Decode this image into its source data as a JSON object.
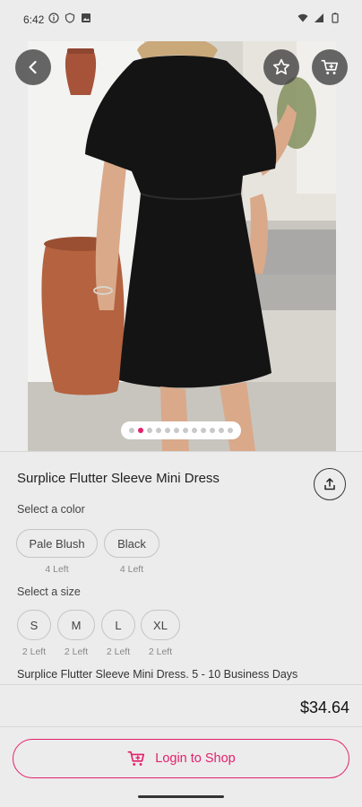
{
  "status_bar": {
    "time": "6:42"
  },
  "product": {
    "title": "Surplice Flutter Sleeve Mini Dress",
    "image_count": 12,
    "active_image_index": 1,
    "color_label": "Select a color",
    "colors": [
      {
        "name": "Pale Blush",
        "stock": "4 Left"
      },
      {
        "name": "Black",
        "stock": "4 Left"
      }
    ],
    "size_label": "Select a size",
    "sizes": [
      {
        "name": "S",
        "stock": "2 Left"
      },
      {
        "name": "M",
        "stock": "2 Left"
      },
      {
        "name": "L",
        "stock": "2 Left"
      },
      {
        "name": "XL",
        "stock": "2 Left"
      }
    ],
    "description": "Surplice Flutter Sleeve Mini Dress. 5 - 10 Business Days",
    "price": "$34.64"
  },
  "actions": {
    "login_label": "Login to Shop"
  },
  "colors": {
    "accent": "#e3216c",
    "background": "#ececec"
  },
  "icons": [
    "back-arrow-icon",
    "star-icon",
    "cart-icon",
    "share-icon"
  ]
}
